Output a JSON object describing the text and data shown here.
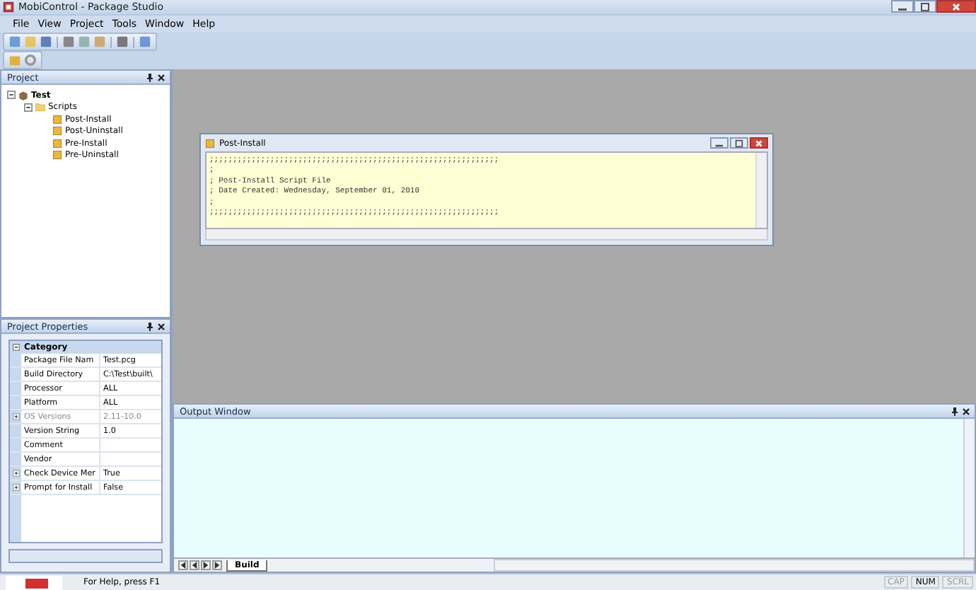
{
  "window": {
    "title": "MobiControl - Package Studio"
  },
  "menu": [
    "File",
    "View",
    "Project",
    "Tools",
    "Window",
    "Help"
  ],
  "project_panel": {
    "title": "Project",
    "tree": [
      {
        "label": "Test",
        "kind": "project",
        "expanded": true,
        "children": [
          {
            "label": "Scripts",
            "kind": "folder",
            "expanded": true,
            "children": [
              {
                "label": "Post-Install",
                "kind": "script"
              },
              {
                "label": "Post-Uninstall",
                "kind": "script"
              },
              {
                "label": "Pre-Install",
                "kind": "script"
              },
              {
                "label": "Pre-Uninstall",
                "kind": "script"
              }
            ]
          }
        ]
      }
    ]
  },
  "properties_panel": {
    "title": "Project Properties",
    "category": "Category",
    "rows": [
      {
        "name": "Package File Nam",
        "value": "Test.pcg",
        "expandable": false,
        "disabled": false
      },
      {
        "name": "Build Directory",
        "value": "C:\\Test\\built\\",
        "expandable": false,
        "disabled": false
      },
      {
        "name": "Processor",
        "value": "ALL",
        "expandable": false,
        "disabled": false
      },
      {
        "name": "Platform",
        "value": "ALL",
        "expandable": false,
        "disabled": false
      },
      {
        "name": "OS Versions",
        "value": "2.11-10.0",
        "expandable": true,
        "disabled": true
      },
      {
        "name": "Version String",
        "value": "1.0",
        "expandable": false,
        "disabled": false
      },
      {
        "name": "Comment",
        "value": "",
        "expandable": false,
        "disabled": false
      },
      {
        "name": "Vendor",
        "value": "",
        "expandable": false,
        "disabled": false
      },
      {
        "name": "Check Device Mer",
        "value": "True",
        "expandable": true,
        "disabled": false
      },
      {
        "name": "Prompt for Install",
        "value": "False",
        "expandable": true,
        "disabled": false
      }
    ]
  },
  "document": {
    "title": "Post-Install",
    "lines": [
      ";;;;;;;;;;;;;;;;;;;;;;;;;;;;;;;;;;;;;;;;;;;;;;;;;;;;;;;;;;;;;;",
      ";",
      "; Post-Install Script File",
      "; Date Created: Wednesday, September 01, 2010",
      ";",
      ";;;;;;;;;;;;;;;;;;;;;;;;;;;;;;;;;;;;;;;;;;;;;;;;;;;;;;;;;;;;;;"
    ]
  },
  "output_panel": {
    "title": "Output Window",
    "tabs": [
      {
        "label": "Build",
        "selected": true
      }
    ]
  },
  "status_bar": {
    "message": "For Help, press F1",
    "indicators": [
      {
        "label": "CAP",
        "on": false
      },
      {
        "label": "NUM",
        "on": true
      },
      {
        "label": "SCRL",
        "on": false
      }
    ]
  }
}
